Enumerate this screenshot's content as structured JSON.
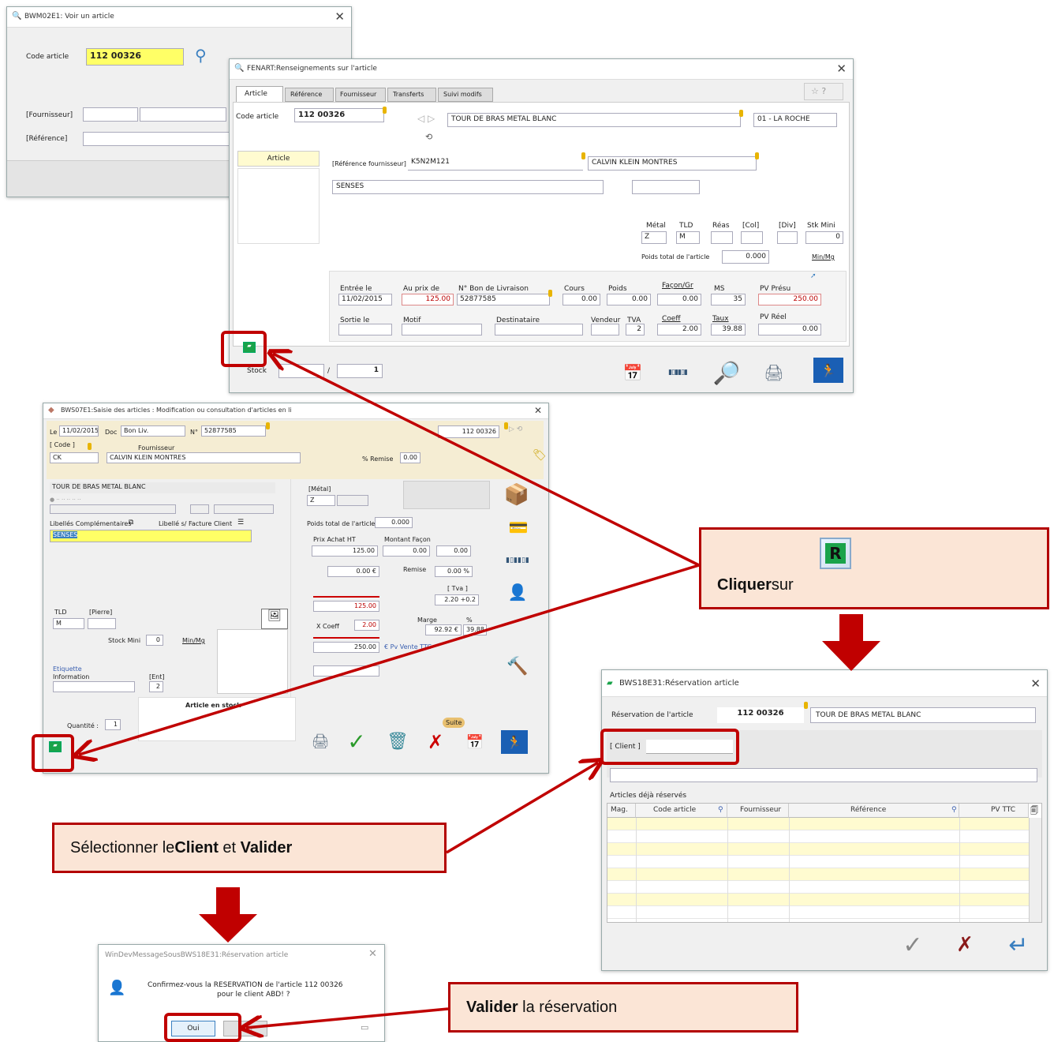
{
  "win1": {
    "title": "BWM02E1: Voir un article",
    "code_label": "Code article",
    "code_value": "112 00326",
    "four_label": "[Fournisseur]",
    "ref_label": "[Référence]"
  },
  "win2": {
    "title": "FENART:Renseignements sur l'article",
    "tabs": [
      "Article",
      "Référence",
      "Fournisseur",
      "Transferts",
      "Suivi modifs"
    ],
    "code_label": "Code article",
    "code_value": "112 00326",
    "designation": "TOUR DE BRAS METAL BLANC",
    "magasin": "01 - LA ROCHE",
    "side_btn": "Article",
    "ref_four_label": "[Référence fournisseur]",
    "ref_four_value": "K5N2M121",
    "fournisseur": "CALVIN KLEIN MONTRES",
    "collection": "SENSES",
    "metal_label": "Métal",
    "metal_value": "Z",
    "tld_label": "TLD",
    "tld_value": "M",
    "reas_label": "Réas",
    "col_label": "[Col]",
    "div_label": "[Div]",
    "stkmini_label": "Stk Mini",
    "stkmini_value": "0",
    "poids_label": "Poids total de l'article",
    "poids_value": "0.000",
    "minmg": "Min/Mg",
    "entree_label": "Entrée le",
    "entree_value": "11/02/2015",
    "auprix_label": "Au prix de",
    "auprix_value": "125.00",
    "bon_label": "N° Bon de Livraison",
    "bon_value": "52877585",
    "cours_label": "Cours",
    "cours_value": "0.00",
    "poidsb_label": "Poids",
    "poidsb_value": "0.00",
    "facon_label": "Façon/Gr",
    "facon_value": "0.00",
    "ms_label": "MS",
    "ms_value": "35",
    "pvpresu_label": "PV Présu",
    "pvpresu_value": "250.00",
    "sortie_label": "Sortie le",
    "motif_label": "Motif",
    "dest_label": "Destinataire",
    "vendeur_label": "Vendeur",
    "tva_label": "TVA",
    "tva_value": "2",
    "coeff_label": "Coeff",
    "coeff_value": "2.00",
    "taux_label": "Taux",
    "taux_value": "39.88",
    "pvreel_label": "PV Réel",
    "pvreel_value": "0.00",
    "stock_label": "Stock",
    "stock_sep": "/",
    "stock_value": "1"
  },
  "win3": {
    "title": "BWS07E1:Saisie des articles : Modification ou consultation d'articles en li",
    "le_label": "Le",
    "le_value": "11/02/2015",
    "doc_label": "Doc",
    "doc_value": "Bon Liv.",
    "num_label": "N°",
    "num_value": "52877585",
    "code_value": "112 00326",
    "code_hdr": "[ Code ]",
    "four_hdr": "Fournisseur",
    "code_short": "CK",
    "four_value": "CALVIN KLEIN MONTRES",
    "remise_label": "% Remise",
    "remise_value": "0.00",
    "designation": "TOUR DE BRAS METAL BLANC",
    "libcomp_label": "Libellés Complémentaires",
    "libfact_label": "Libellé s/ Facture Client",
    "libcomp_value": "SENSES",
    "metal_label": "[Métal]",
    "metal_value": "Z",
    "poids_label": "Poids total de l'article",
    "poids_value": "0.000",
    "prixachat_label": "Prix Achat HT",
    "prixachat_value": "125.00",
    "montfacon_label": "Montant Façon",
    "montfacon_value": "0.00",
    "eur_value": "0.00",
    "remval": "0.00 €",
    "remise2_label": "Remise",
    "remise2_value": "0.00 %",
    "tva_hdr": "[ Tva ]",
    "tva_value": "2.20 +0.2",
    "v125": "125.00",
    "coeff_label": "X Coeff",
    "coeff_value": "2.00",
    "marge_label": "Marge",
    "pct": "%",
    "marge_value": "92.92 €",
    "marge_pct": "39.88",
    "pv_value": "250.00",
    "pv_label": "€ Pv Vente TTC",
    "tld_label": "TLD",
    "tld_value": "M",
    "pierre_label": "[Pierre]",
    "stockmin_label": "Stock Mini",
    "stockmin_value": "0",
    "minmg": "Min/Mg",
    "etiquette_label": "Etiquette",
    "info_label": "Information",
    "ent_label": "[Ent]",
    "ent_value": "2",
    "quantite_label": "Quantité :",
    "quantite_value": "1",
    "stock_text": "Article en stock",
    "suite": "Suite"
  },
  "win4": {
    "title": "BWS18E31:Réservation article",
    "resa_label": "Réservation de l'article",
    "code_value": "112 00326",
    "designation": "TOUR DE BRAS METAL BLANC",
    "client_label": "[ Client ]",
    "deja_label": "Articles déjà réservés",
    "columns": [
      "Mag.",
      "Code article",
      "Fournisseur",
      "Référence",
      "PV TTC"
    ]
  },
  "win5": {
    "title": "WinDevMessageSousBWS18E31:Réservation article",
    "line1": "Confirmez-vous la RESERVATION de l'article 112 00326",
    "line2": "pour le client ABD! ?",
    "ok": "Oui",
    "no": "Non"
  },
  "callouts": {
    "cliquer_bold": "Cliquer",
    "cliquer_rest": " sur",
    "selectionner_pre": "Sélectionner le ",
    "client": "Client",
    "et": " et ",
    "valider": "Valider",
    "valider_rest": " la réservation"
  },
  "colors": {
    "accent": "#c00000",
    "callout_bg": "#fbe5d6",
    "highlight_yellow": "#ffff66"
  }
}
